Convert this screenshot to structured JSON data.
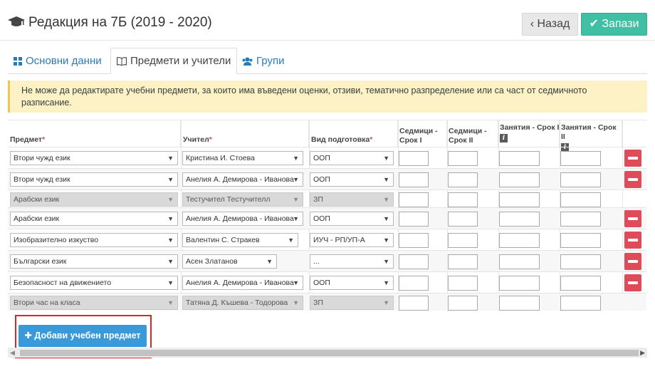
{
  "header": {
    "title": "Редакция на 7Б (2019 - 2020)",
    "back_label": "Назад",
    "save_label": "Запази"
  },
  "tabs": [
    {
      "label": "Основни данни"
    },
    {
      "label": "Предмети и учители"
    },
    {
      "label": "Групи"
    }
  ],
  "alert": {
    "line1": "Не може да редактирате учебни предмети, за които има въведени оценки, отзиви, тематично разпределение или са част от седмичното",
    "line2": "разписание."
  },
  "table": {
    "headers": {
      "subject": "Предмет",
      "teacher": "Учител",
      "prep": "Вид подготовка",
      "weeks1": "Седмици - Срок I",
      "weeks2": "Седмици - Срок II",
      "classes1": "Занятия - Срок I",
      "classes2": "Занятия - Срок II",
      "required_mark": "*"
    },
    "rows": [
      {
        "subject": "Втори чужд език",
        "teacher": "Кристина И. Стоева",
        "prep": "ООП"
      },
      {
        "subject": "Втори чужд език",
        "teacher": "Анелия А. Демирова - Иванова",
        "prep": "ООП"
      },
      {
        "subject": "Арабски език",
        "teacher": "Тестучител Тестучителл",
        "prep": "ЗП"
      },
      {
        "subject": "Арабски език",
        "teacher": "Анелия А. Демирова - Иванова",
        "prep": "ООП"
      },
      {
        "subject": "Изобразително изкуство",
        "teacher": "Валентин С. Стракев",
        "prep": "ИУЧ - РП/УП-А"
      },
      {
        "subject": "Български език",
        "teacher": "Асен Златанов",
        "prep": "..."
      },
      {
        "subject": "Безопасност на движението",
        "teacher": "Анелия А. Демирова - Иванова",
        "prep": "ООП"
      },
      {
        "subject": "Втори час на класа",
        "teacher": "Татяна Д. Къшева - Тодорова",
        "prep": "ЗП"
      }
    ]
  },
  "add_button": {
    "label": "Добави учебен предмет"
  },
  "icons": {
    "title": "graduation-cap-icon",
    "back": "chevron-left-icon",
    "save": "check-icon",
    "info": "info-icon",
    "remove": "minus-icon"
  },
  "colors": {
    "primary": "#3a9ad9",
    "success": "#3fbfa3",
    "danger": "#e04b59",
    "warning_bg": "#fcf2c6",
    "link": "#2a7ab8"
  }
}
